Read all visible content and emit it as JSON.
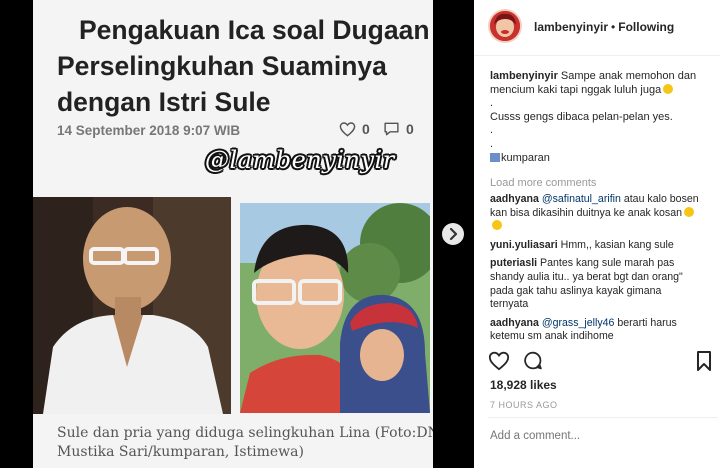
{
  "post_image": {
    "headline_lines": [
      "Pengakuan Ica soal Dugaan",
      "Perselingkuhan Suaminya",
      "dengan Istri Sule"
    ],
    "date": "14 September 2018 9:07 WIB",
    "like_count": "0",
    "comment_count": "0",
    "watermark": "@lambenyinyir",
    "caption_lines": [
      "Sule dan pria yang diduga selingkuhan Lina (Foto:DN",
      "Mustika Sari/kumparan, Istimewa)"
    ]
  },
  "header": {
    "username": "lambenyinyir",
    "dot": "•",
    "follow_status": "Following"
  },
  "caption": {
    "username": "lambenyinyir",
    "line1_text": " Sampe anak memohon dan",
    "line2_text": "mencium kaki tapi nggak luluh juga",
    "dot1": ".",
    "line3": "Cusss gengs dibaca pelan-pelan yes.",
    "dot2": ".",
    "dot3": ".",
    "line4": "kumparan"
  },
  "load_more": "Load more comments",
  "comments": [
    {
      "user": "aadhyana",
      "mention": "@safinatul_arifin",
      "lines": [
        " atau kalo bosen",
        "kan bisa dikasihin duitnya ke anak kosan"
      ]
    },
    {
      "user": "yuni.yuliasari",
      "text": " Hmm,, kasian kang sule"
    },
    {
      "user": "puteriasli",
      "lines": [
        " Pantes kang sule marah pas",
        "shandy aulia itu.. ya berat bgt dan orang\"",
        "pada gak tahu aslinya kayak gimana",
        "ternyata"
      ]
    },
    {
      "user": "aadhyana",
      "mention": "@grass_jelly46",
      "lines": [
        " berarti harus",
        "ketemu sm anak indihome"
      ]
    }
  ],
  "likes": "18,928 likes",
  "time": "7 HOURS AGO",
  "add_comment_placeholder": "Add a comment...",
  "colors": {
    "mention": "#003569",
    "background": "#000000"
  }
}
